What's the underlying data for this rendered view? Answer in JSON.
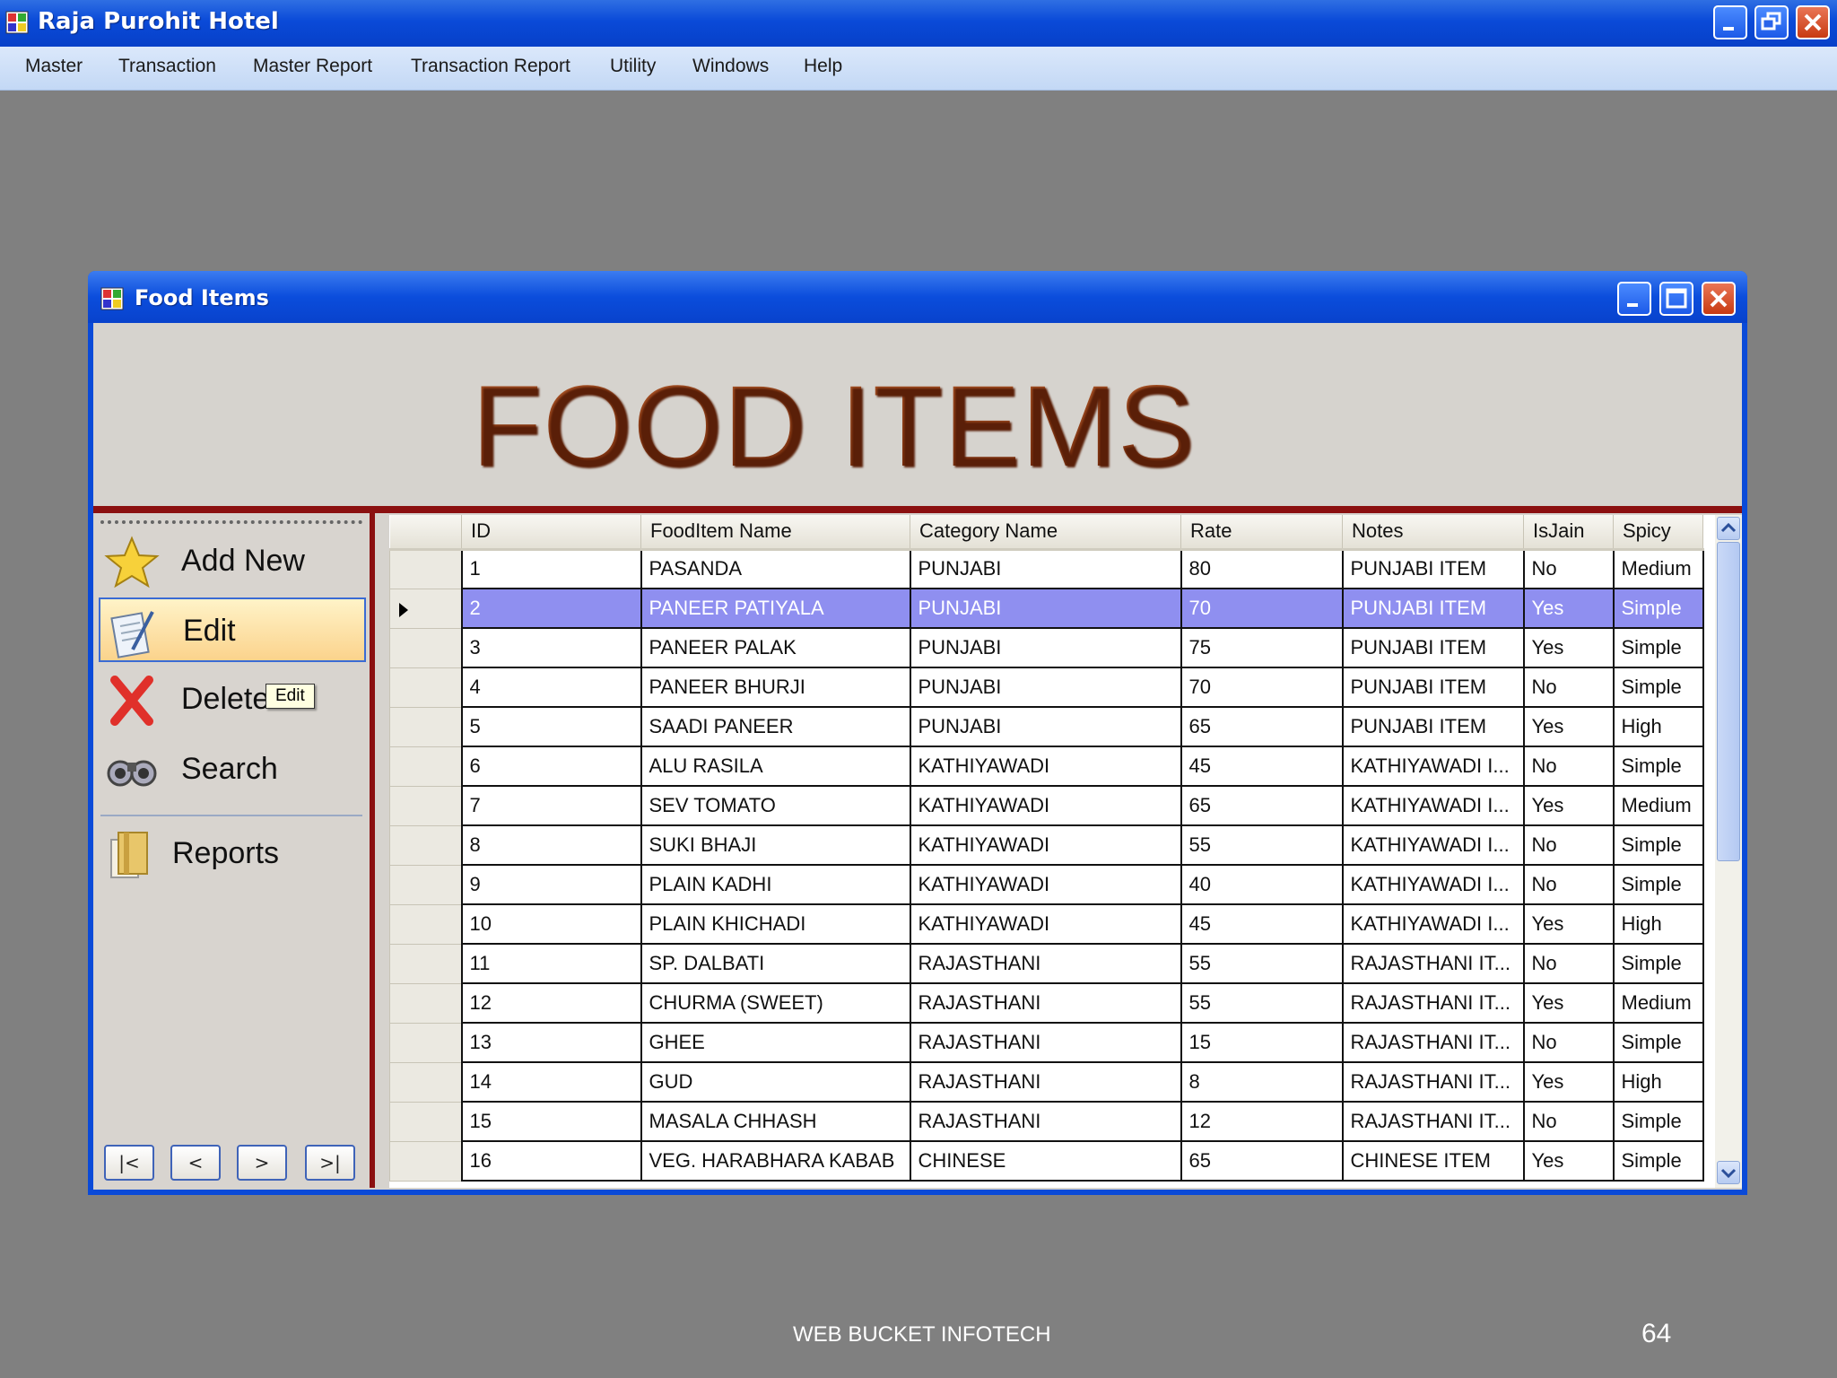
{
  "app": {
    "title": "Raja Purohit Hotel"
  },
  "menu": [
    "Master",
    "Transaction",
    "Master Report",
    "Transaction Report",
    "Utility",
    "Windows",
    "Help"
  ],
  "child": {
    "title": "Food Items",
    "header": "FOOD ITEMS"
  },
  "nav": {
    "add_new": "Add New",
    "edit": "Edit",
    "delete": "Delete",
    "search": "Search",
    "reports": "Reports",
    "tooltip": "Edit"
  },
  "record_nav": {
    "first": "|<",
    "prev": "<",
    "next": ">",
    "last": ">|"
  },
  "grid": {
    "columns": [
      "ID",
      "FoodItem Name",
      "Category Name",
      "Rate",
      "Notes",
      "IsJain",
      "Spicy"
    ],
    "selected_row": 2,
    "rows": [
      [
        "1",
        "PASANDA",
        "PUNJABI",
        "80",
        "PUNJABI ITEM",
        "No",
        "Medium"
      ],
      [
        "2",
        "PANEER PATIYALA",
        "PUNJABI",
        "70",
        "PUNJABI ITEM",
        "Yes",
        "Simple"
      ],
      [
        "3",
        "PANEER PALAK",
        "PUNJABI",
        "75",
        "PUNJABI ITEM",
        "Yes",
        "Simple"
      ],
      [
        "4",
        "PANEER BHURJI",
        "PUNJABI",
        "70",
        "PUNJABI ITEM",
        "No",
        "Simple"
      ],
      [
        "5",
        "SAADI PANEER",
        "PUNJABI",
        "65",
        "PUNJABI ITEM",
        "Yes",
        "High"
      ],
      [
        "6",
        "ALU RASILA",
        "KATHIYAWADI",
        "45",
        "KATHIYAWADI I...",
        "No",
        "Simple"
      ],
      [
        "7",
        "SEV TOMATO",
        "KATHIYAWADI",
        "65",
        "KATHIYAWADI I...",
        "Yes",
        "Medium"
      ],
      [
        "8",
        "SUKI BHAJI",
        "KATHIYAWADI",
        "55",
        "KATHIYAWADI I...",
        "No",
        "Simple"
      ],
      [
        "9",
        "PLAIN KADHI",
        "KATHIYAWADI",
        "40",
        "KATHIYAWADI I...",
        "No",
        "Simple"
      ],
      [
        "10",
        "PLAIN KHICHADI",
        "KATHIYAWADI",
        "45",
        "KATHIYAWADI I...",
        "Yes",
        "High"
      ],
      [
        "11",
        "SP. DALBATI",
        "RAJASTHANI",
        "55",
        "RAJASTHANI IT...",
        "No",
        "Simple"
      ],
      [
        "12",
        "CHURMA (SWEET)",
        "RAJASTHANI",
        "55",
        "RAJASTHANI IT...",
        "Yes",
        "Medium"
      ],
      [
        "13",
        "GHEE",
        "RAJASTHANI",
        "15",
        "RAJASTHANI IT...",
        "No",
        "Simple"
      ],
      [
        "14",
        "GUD",
        "RAJASTHANI",
        "8",
        "RAJASTHANI IT...",
        "Yes",
        "High"
      ],
      [
        "15",
        "MASALA CHHASH",
        "RAJASTHANI",
        "12",
        "RAJASTHANI IT...",
        "No",
        "Simple"
      ],
      [
        "16",
        "VEG. HARABHARA KABAB",
        "CHINESE",
        "65",
        "CHINESE ITEM",
        "Yes",
        "Simple"
      ]
    ]
  },
  "footer": {
    "company": "WEB BUCKET INFOTECH",
    "page": "64"
  }
}
